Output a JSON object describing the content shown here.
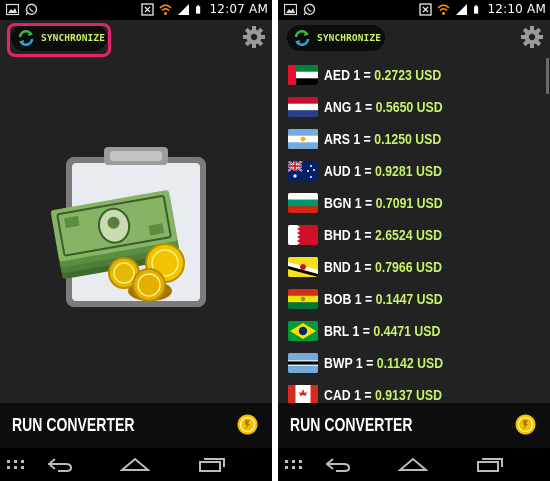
{
  "colors": {
    "accent_green": "#c9f26a",
    "highlight_pink": "#e0256b",
    "background": "#222222"
  },
  "left": {
    "status_bar": {
      "time": "12:07 AM"
    },
    "top_bar": {
      "sync_label": "SYNCHRONIZE",
      "settings_icon": "gear-icon"
    },
    "bottom": {
      "run_label": "RUN CONVERTER"
    }
  },
  "right": {
    "status_bar": {
      "time": "12:10 AM"
    },
    "top_bar": {
      "sync_label": "SYNCHRONIZE",
      "settings_icon": "gear-icon"
    },
    "currencies": [
      {
        "code": "AED",
        "eq": "1 =",
        "value": "0.2723 USD"
      },
      {
        "code": "ANG",
        "eq": "1 =",
        "value": "0.5650 USD"
      },
      {
        "code": "ARS",
        "eq": "1 =",
        "value": "0.1250 USD"
      },
      {
        "code": "AUD",
        "eq": "1 =",
        "value": "0.9281 USD"
      },
      {
        "code": "BGN",
        "eq": "1 =",
        "value": "0.7091 USD"
      },
      {
        "code": "BHD",
        "eq": "1 =",
        "value": "2.6524 USD"
      },
      {
        "code": "BND",
        "eq": "1 =",
        "value": "0.7966 USD"
      },
      {
        "code": "BOB",
        "eq": "1 =",
        "value": "0.1447 USD"
      },
      {
        "code": "BRL",
        "eq": "1 =",
        "value": "0.4471 USD"
      },
      {
        "code": "BWP",
        "eq": "1 =",
        "value": "0.1142 USD"
      },
      {
        "code": "CAD",
        "eq": "1 =",
        "value": "0.9137 USD"
      }
    ],
    "bottom": {
      "run_label": "RUN CONVERTER"
    }
  }
}
